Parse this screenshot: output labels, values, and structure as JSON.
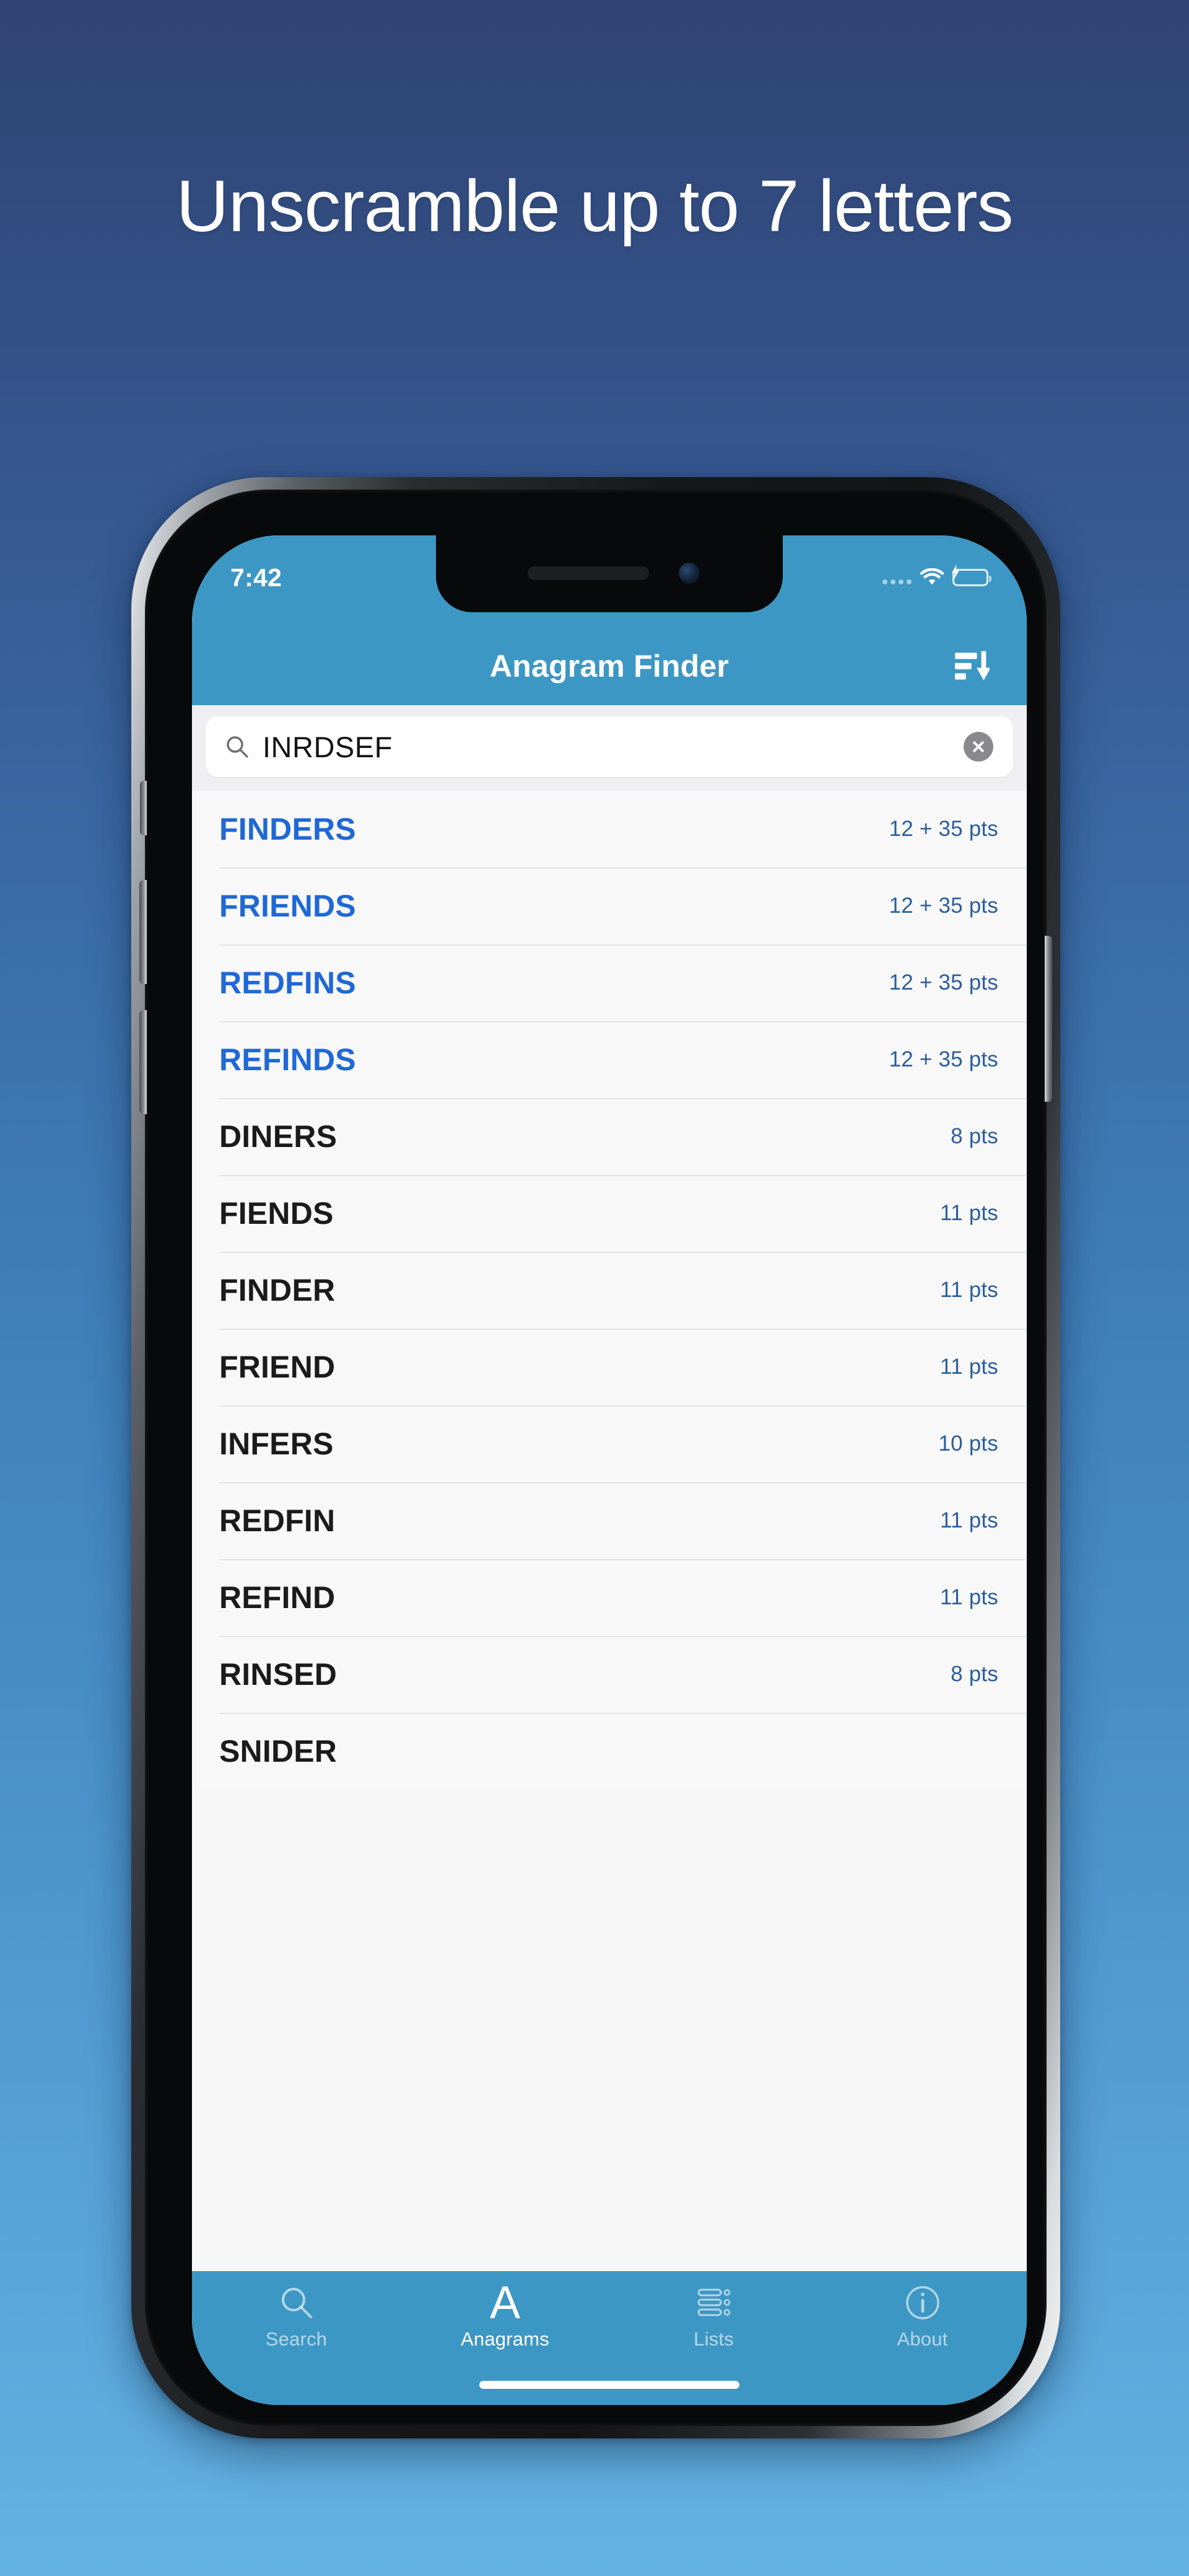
{
  "promo": {
    "headline": "Unscramble up to 7 letters",
    "background_top_color": "#2f4374",
    "background_bottom_color": "#63b2e2"
  },
  "statusbar": {
    "time": "7:42",
    "wifi_icon": "wifi-icon",
    "battery_icon": "battery-charging-icon",
    "signal_icon": "signal-dots-icon"
  },
  "navbar": {
    "title": "Anagram Finder",
    "sort_icon": "sort-descending-icon",
    "background_color": "#3d97c4"
  },
  "search": {
    "value": "INRDSEF",
    "placeholder": "Enter letters",
    "search_icon": "search-icon",
    "clear_icon": "clear-circle-icon"
  },
  "results": {
    "rows": [
      {
        "word": "FINDERS",
        "score": "12 + 35 pts",
        "bonus": true
      },
      {
        "word": "FRIENDS",
        "score": "12 + 35 pts",
        "bonus": true
      },
      {
        "word": "REDFINS",
        "score": "12 + 35 pts",
        "bonus": true
      },
      {
        "word": "REFINDS",
        "score": "12 + 35 pts",
        "bonus": true
      },
      {
        "word": "DINERS",
        "score": "8 pts",
        "bonus": false
      },
      {
        "word": "FIENDS",
        "score": "11 pts",
        "bonus": false
      },
      {
        "word": "FINDER",
        "score": "11 pts",
        "bonus": false
      },
      {
        "word": "FRIEND",
        "score": "11 pts",
        "bonus": false
      },
      {
        "word": "INFERS",
        "score": "10 pts",
        "bonus": false
      },
      {
        "word": "REDFIN",
        "score": "11 pts",
        "bonus": false
      },
      {
        "word": "REFIND",
        "score": "11 pts",
        "bonus": false
      },
      {
        "word": "RINSED",
        "score": "8 pts",
        "bonus": false
      },
      {
        "word": "SNIDER",
        "score": "",
        "bonus": false
      }
    ],
    "bonus_word_color": "#1f68d6",
    "word_color": "#1b1b1b",
    "score_color": "#2b5e9c"
  },
  "tabbar": {
    "background_color": "#3d97c4",
    "tabs": [
      {
        "label": "Search",
        "icon": "search-icon",
        "active": false
      },
      {
        "label": "Anagrams",
        "icon": "letter-a-icon",
        "active": true
      },
      {
        "label": "Lists",
        "icon": "list-icon",
        "active": false
      },
      {
        "label": "About",
        "icon": "info-icon",
        "active": false
      }
    ]
  }
}
